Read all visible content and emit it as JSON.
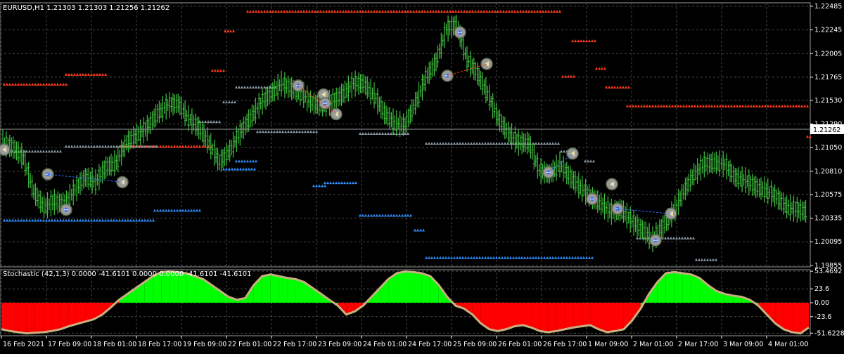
{
  "header": {
    "main": "EURUSD,H1  1.21303 1.21303 1.21256 1.21262",
    "stoch": "Stochastic (42,1,3) 0.0000 -41.6101 0.0000 0.0000 -41.6101 -41.6101"
  },
  "current_price_label": "1.21262",
  "colors": {
    "background": "#000000",
    "grid": "#4a4a4a",
    "candles": "#3fbf3f",
    "resistance": "#ff3b1f",
    "support": "#2f8fff",
    "neutral": "#8a98a4",
    "stoch_pos": "#00ff00",
    "stoch_neg": "#ff0000",
    "stoch_line": "#c8b080"
  },
  "chart_data": [
    {
      "type": "line",
      "symbol": "EURUSD",
      "timeframe": "H1",
      "ohlc": {
        "open": 1.21303,
        "high": 1.21303,
        "low": 1.21256,
        "close": 1.21262
      },
      "y_ticks": [
        "1.22485",
        "1.22245",
        "1.22005",
        "1.21765",
        "1.21530",
        "1.21290",
        "1.21050",
        "1.20810",
        "1.20575",
        "1.20335",
        "1.20095",
        "1.19855"
      ],
      "ylim": [
        1.1984,
        1.2252
      ],
      "x_ticks": [
        "16 Feb 2021",
        "17 Feb 09:00",
        "18 Feb 01:00",
        "18 Feb 17:00",
        "19 Feb 09:00",
        "22 Feb 01:00",
        "22 Feb 17:00",
        "23 Feb 09:00",
        "24 Feb 01:00",
        "24 Feb 17:00",
        "25 Feb 09:00",
        "26 Feb 01:00",
        "26 Feb 17:00",
        "1 Mar 09:00",
        "2 Mar 01:00",
        "2 Mar 17:00",
        "3 Mar 09:00",
        "4 Mar 01:00"
      ],
      "close_series": [
        1.211,
        1.2105,
        1.2095,
        1.206,
        1.2045,
        1.205,
        1.2048,
        1.2062,
        1.2075,
        1.207,
        1.2085,
        1.209,
        1.211,
        1.2118,
        1.2125,
        1.214,
        1.2148,
        1.215,
        1.2135,
        1.2125,
        1.211,
        1.209,
        1.2102,
        1.212,
        1.2135,
        1.215,
        1.216,
        1.217,
        1.2165,
        1.216,
        1.215,
        1.2148,
        1.2152,
        1.216,
        1.217,
        1.217,
        1.2158,
        1.214,
        1.213,
        1.2128,
        1.215,
        1.2175,
        1.2192,
        1.2225,
        1.223,
        1.2195,
        1.218,
        1.216,
        1.2135,
        1.212,
        1.211,
        1.211,
        1.2082,
        1.2078,
        1.2088,
        1.2075,
        1.2065,
        1.2055,
        1.2048,
        1.204,
        1.2042,
        1.203,
        1.2022,
        1.2012,
        1.2025,
        1.204,
        1.206,
        1.2078,
        1.2088,
        1.209,
        1.2088,
        1.2075,
        1.2072,
        1.2065,
        1.2062,
        1.2055,
        1.2045,
        1.2042,
        1.204
      ],
      "resistance_levels": [
        1.2168,
        1.2178,
        1.2182,
        1.2242,
        1.2222,
        1.2158,
        1.2176,
        1.2212,
        1.2184,
        1.2165,
        1.2146,
        1.2115,
        1.2105
      ],
      "support_levels": [
        1.203,
        1.204,
        1.2082,
        1.209,
        1.2065,
        1.2068,
        1.2035,
        1.202,
        1.1992
      ],
      "neutral_levels": [
        1.21,
        1.2105,
        1.213,
        1.215,
        1.2165,
        1.212,
        1.2118,
        1.2108,
        1.21,
        1.209,
        1.2012,
        1.199
      ]
    },
    {
      "type": "area",
      "title": "Stochastic (42,1,3)",
      "y_ticks": [
        "53.4692",
        "23.6",
        "0.00",
        "-23.6",
        "-51.6228"
      ],
      "ylim": [
        -56,
        56
      ],
      "values": [
        -45,
        -48,
        -50,
        -52,
        -51,
        -50,
        -48,
        -45,
        -40,
        -36,
        -32,
        -28,
        -20,
        -8,
        5,
        15,
        25,
        35,
        45,
        52,
        53,
        52,
        50,
        45,
        40,
        30,
        20,
        10,
        5,
        8,
        30,
        45,
        48,
        45,
        42,
        40,
        35,
        25,
        15,
        5,
        -5,
        -20,
        -15,
        -5,
        10,
        25,
        40,
        50,
        53,
        52,
        50,
        45,
        30,
        10,
        -5,
        -10,
        -20,
        -35,
        -45,
        -48,
        -45,
        -40,
        -38,
        -42,
        -48,
        -50,
        -48,
        -45,
        -42,
        -40,
        -38,
        -45,
        -50,
        -48,
        -45,
        -30,
        -10,
        15,
        35,
        50,
        52,
        50,
        48,
        42,
        30,
        20,
        15,
        12,
        10,
        5,
        -5,
        -20,
        -35,
        -45,
        -50,
        -52,
        -42
      ]
    }
  ]
}
